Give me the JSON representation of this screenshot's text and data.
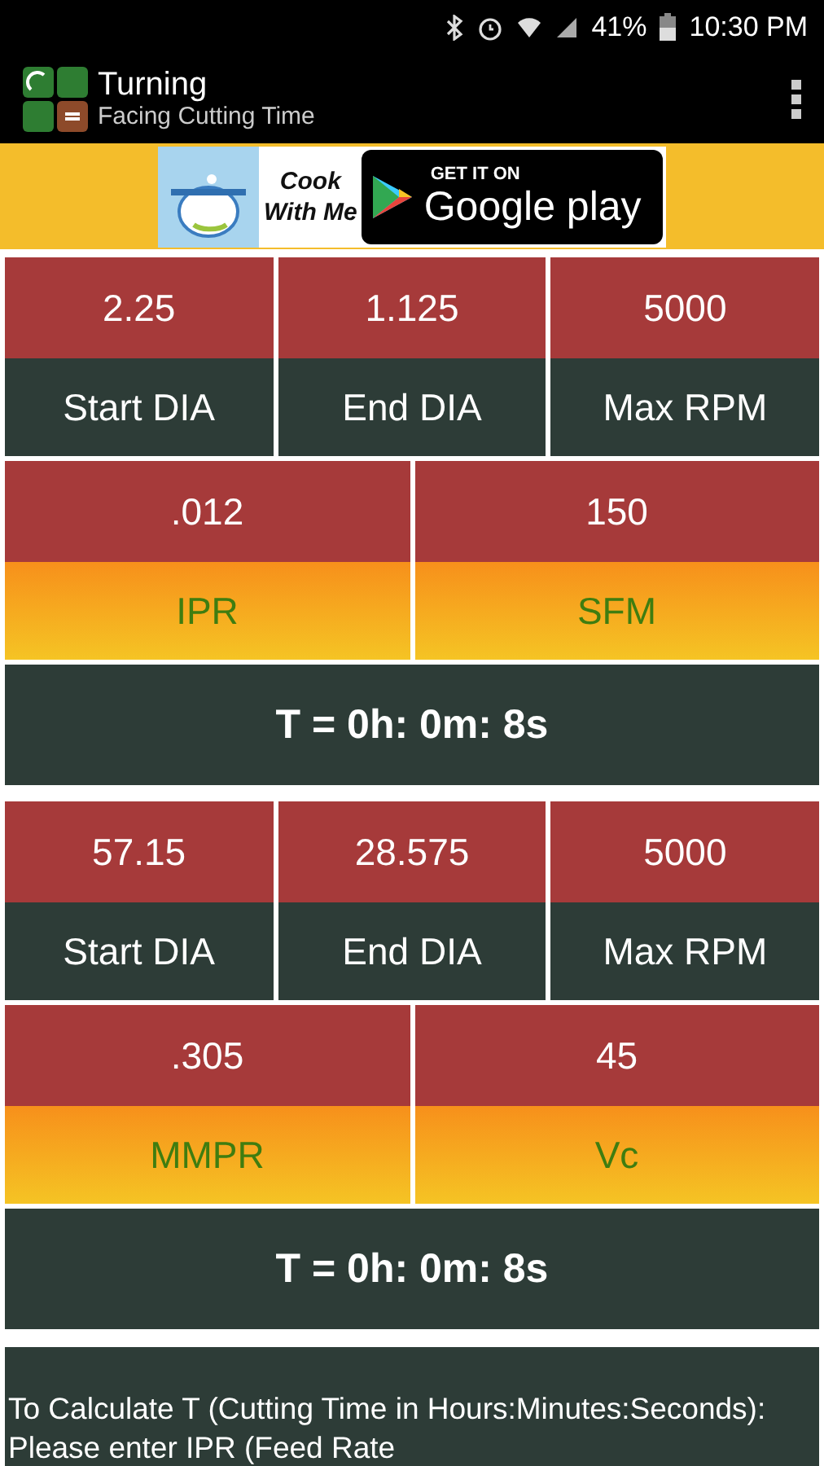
{
  "status_bar": {
    "battery": "41%",
    "time": "10:30 PM"
  },
  "app_bar": {
    "title": "Turning",
    "subtitle": "Facing Cutting Time"
  },
  "ad": {
    "app_name_line1": "Cook",
    "app_name_line2": "With Me",
    "store_caption": "GET IT ON",
    "store_name": "Google play"
  },
  "sections": [
    {
      "inputs_top": [
        {
          "value": "2.25",
          "label": "Start DIA"
        },
        {
          "value": "1.125",
          "label": "End DIA"
        },
        {
          "value": "5000",
          "label": "Max RPM"
        }
      ],
      "inputs_bottom": [
        {
          "value": ".012",
          "label": "IPR"
        },
        {
          "value": "150",
          "label": "SFM"
        }
      ],
      "result": "T = 0h: 0m: 8s"
    },
    {
      "inputs_top": [
        {
          "value": "57.15",
          "label": "Start DIA"
        },
        {
          "value": "28.575",
          "label": "End DIA"
        },
        {
          "value": "5000",
          "label": "Max RPM"
        }
      ],
      "inputs_bottom": [
        {
          "value": ".305",
          "label": "MMPR"
        },
        {
          "value": "45",
          "label": "Vc"
        }
      ],
      "result": "T = 0h: 0m: 8s"
    }
  ],
  "info": "To Calculate T (Cutting Time in Hours:Minutes:Seconds): Please enter IPR (Feed Rate"
}
